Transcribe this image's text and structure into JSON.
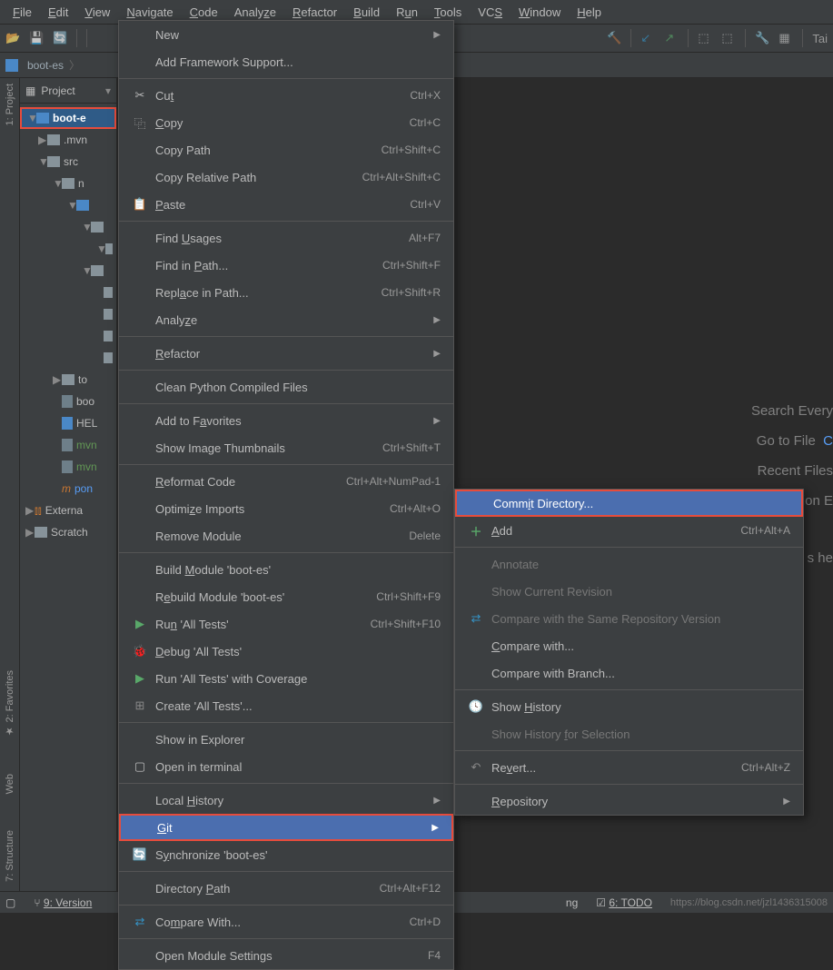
{
  "menubar": [
    "File",
    "Edit",
    "View",
    "Navigate",
    "Code",
    "Analyze",
    "Refactor",
    "Build",
    "Run",
    "Tools",
    "VCS",
    "Window",
    "Help"
  ],
  "breadcrumb": "boot-es",
  "panel": {
    "title": "Project"
  },
  "tree": {
    "root": "boot-e",
    "mvn": ".mvn",
    "src": "src",
    "n1": "n",
    "to": "to",
    "boo": "boo",
    "hel": "HEL",
    "mvn1": "mvn",
    "mvn2": "mvn",
    "pom": "pon",
    "ext": "Externa",
    "scr": "Scratch"
  },
  "rails": {
    "project": "1: Project",
    "favorites": "2: Favorites",
    "web": "Web",
    "structure": "7: Structure"
  },
  "hints": {
    "search": "Search Every",
    "gotofile_a": "Go to File",
    "gotofile_b": "C",
    "recent": "Recent Files",
    "nav": "Navigation E",
    "here": "s he"
  },
  "status": {
    "version": "9: Version",
    "running": "ng",
    "todo": "6: TODO",
    "watermark": "https://blog.csdn.net/jzl1436315008"
  },
  "menu": {
    "new": "New",
    "addfw": "Add Framework Support...",
    "cut": "Cut",
    "cut_s": "Ctrl+X",
    "copy": "Copy",
    "copy_s": "Ctrl+C",
    "copypath": "Copy Path",
    "copypath_s": "Ctrl+Shift+C",
    "copyrel": "Copy Relative Path",
    "copyrel_s": "Ctrl+Alt+Shift+C",
    "paste": "Paste",
    "paste_s": "Ctrl+V",
    "findu": "Find Usages",
    "findu_s": "Alt+F7",
    "findp": "Find in Path...",
    "findp_s": "Ctrl+Shift+F",
    "replp": "Replace in Path...",
    "replp_s": "Ctrl+Shift+R",
    "analyze": "Analyze",
    "refactor": "Refactor",
    "cleanpy": "Clean Python Compiled Files",
    "addfav": "Add to Favorites",
    "thumbs": "Show Image Thumbnails",
    "thumbs_s": "Ctrl+Shift+T",
    "reformat": "Reformat Code",
    "reformat_s": "Ctrl+Alt+NumPad-1",
    "optimp": "Optimize Imports",
    "optimp_s": "Ctrl+Alt+O",
    "rmmod": "Remove Module",
    "rmmod_s": "Delete",
    "buildm": "Build Module 'boot-es'",
    "rebuildm": "Rebuild Module 'boot-es'",
    "rebuildm_s": "Ctrl+Shift+F9",
    "runall": "Run 'All Tests'",
    "runall_s": "Ctrl+Shift+F10",
    "debugall": "Debug 'All Tests'",
    "covall": "Run 'All Tests' with Coverage",
    "createall": "Create 'All Tests'...",
    "showexp": "Show in Explorer",
    "openterm": "Open in terminal",
    "localhist": "Local History",
    "git": "Git",
    "sync": "Synchronize 'boot-es'",
    "dirpath": "Directory Path",
    "dirpath_s": "Ctrl+Alt+F12",
    "compare": "Compare With...",
    "compare_s": "Ctrl+D",
    "openmod": "Open Module Settings",
    "openmod_s": "F4"
  },
  "submenu": {
    "commit": "Commit Directory...",
    "add": "Add",
    "add_s": "Ctrl+Alt+A",
    "annot": "Annotate",
    "showrev": "Show Current Revision",
    "cmpsame": "Compare with the Same Repository Version",
    "cmpwith": "Compare with...",
    "cmpbranch": "Compare with Branch...",
    "showhist": "Show History",
    "showhistsel": "Show History for Selection",
    "revert": "Revert...",
    "revert_s": "Ctrl+Alt+Z",
    "repo": "Repository"
  }
}
